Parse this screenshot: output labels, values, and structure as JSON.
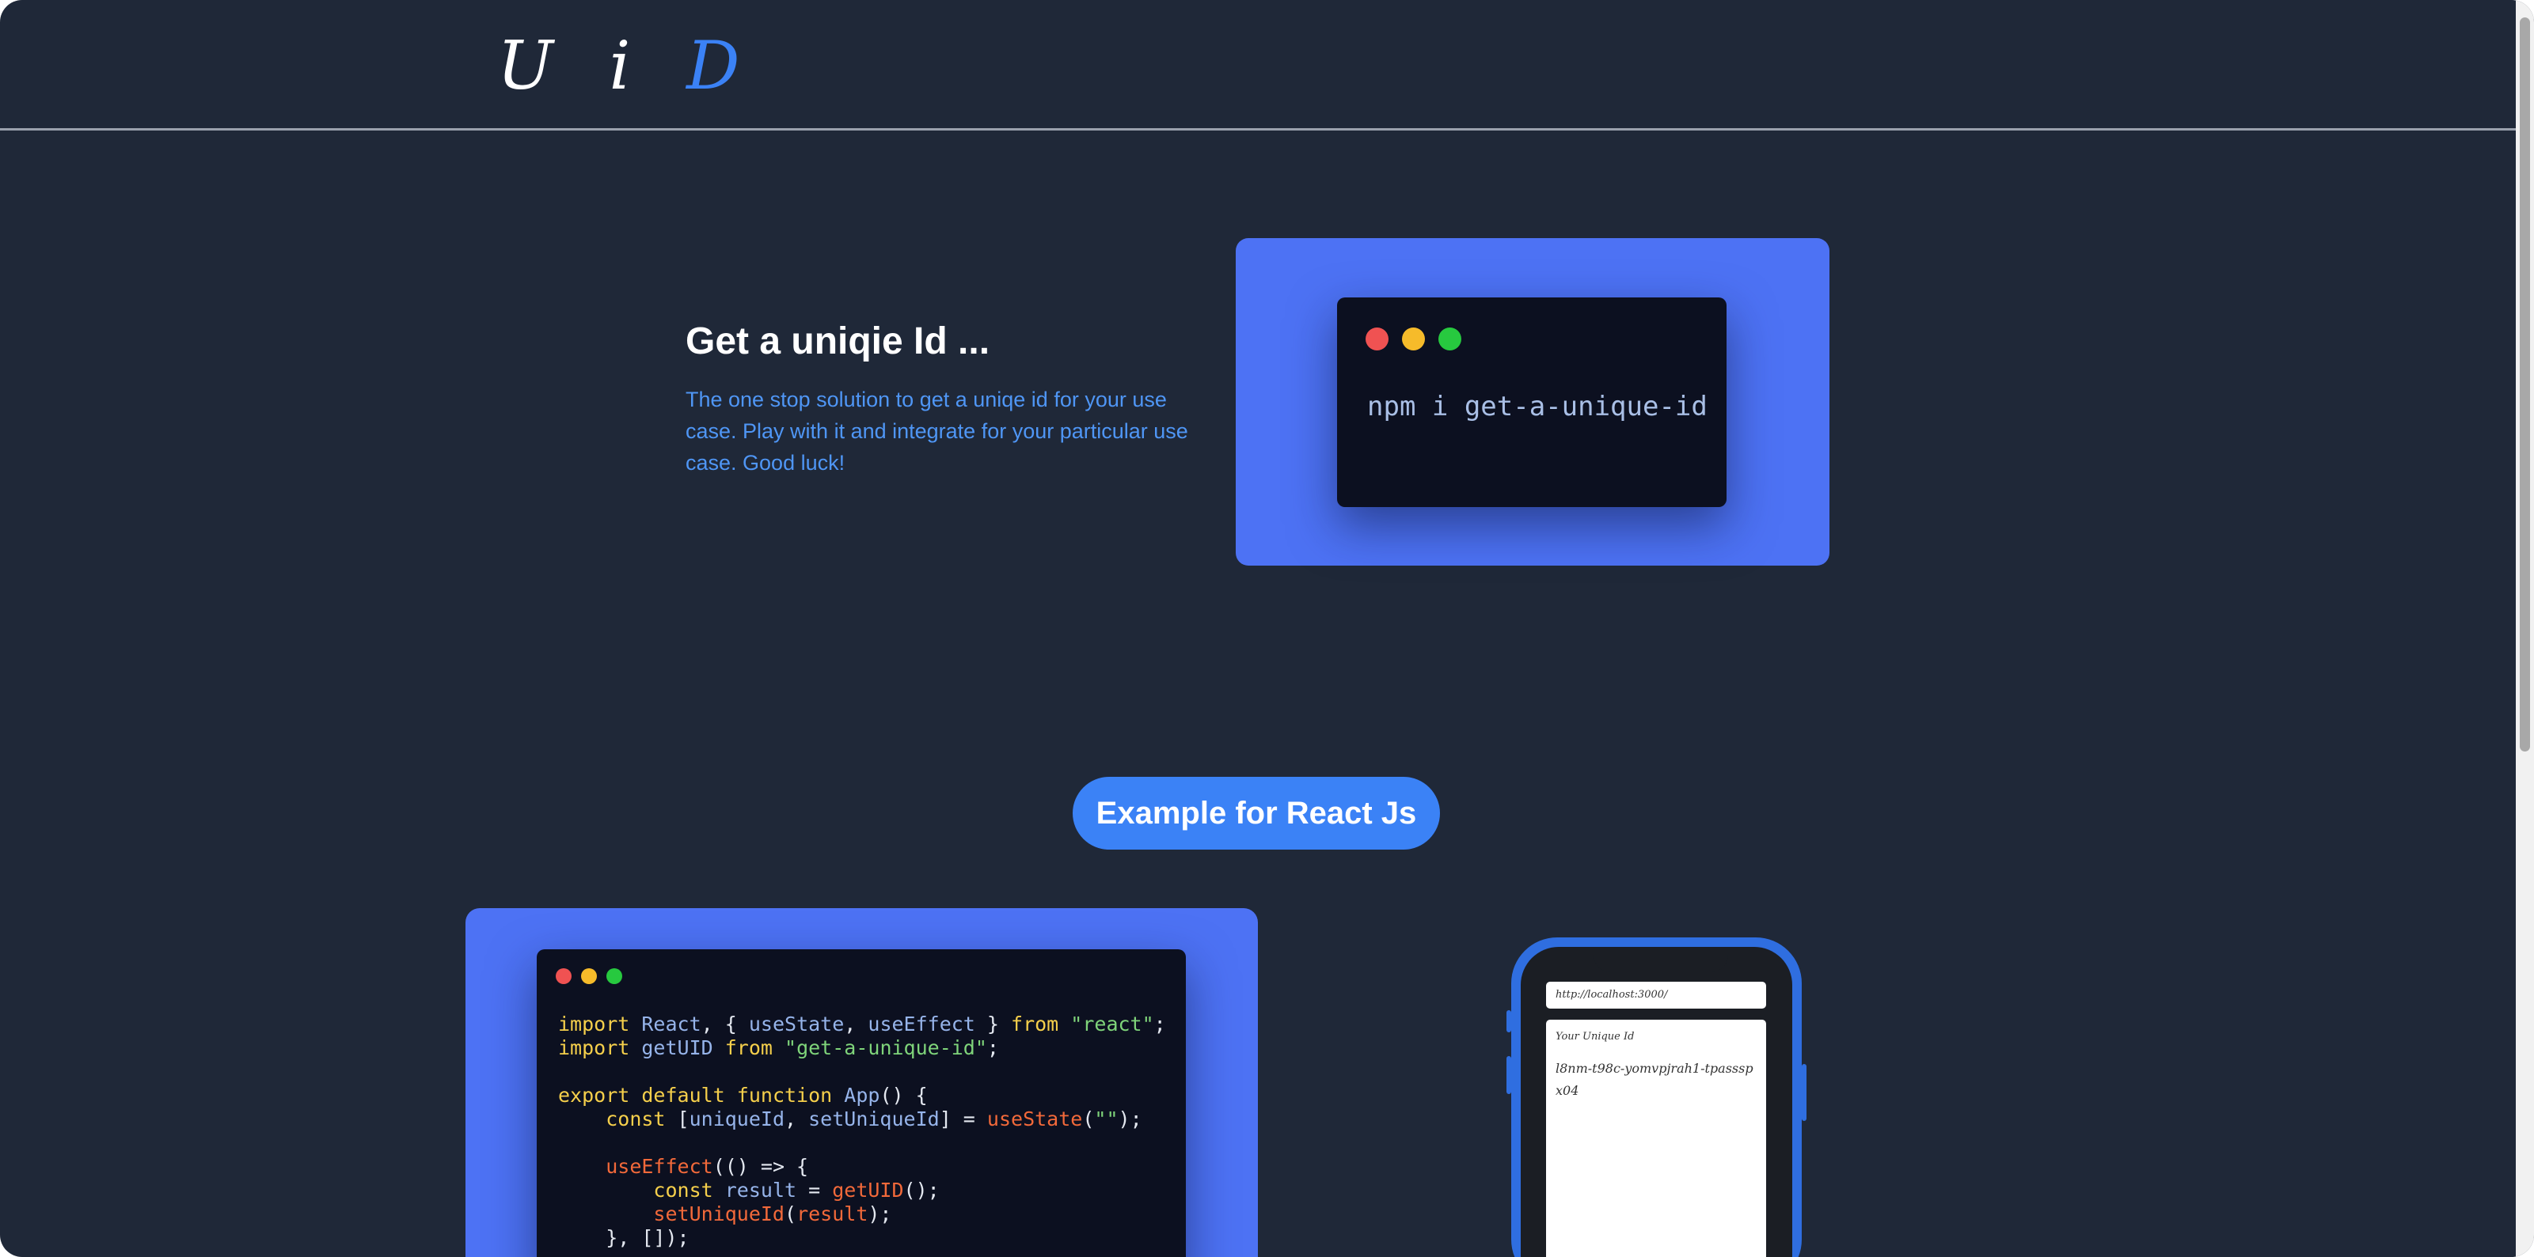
{
  "header": {
    "logo_main": "U i ",
    "logo_accent": "D"
  },
  "hero": {
    "title": "Get a uniqie Id ...",
    "description": "The one stop solution to get a uniqe id for your use case. Play with it and integrate for your particular use case. Good luck!",
    "install_command": "npm i get-a-unique-id"
  },
  "example": {
    "button_label": "Example for React Js",
    "code_tokens": {
      "import": "import",
      "react": "React",
      "open_brace": ", { ",
      "use_state": "useState",
      "comma": ", ",
      "use_effect": "useEffect",
      "close_brace": " } ",
      "from": "from",
      "react_str": "\"react\"",
      "semi": ";",
      "get_uid": "getUID",
      "pkg_str": "\"get-a-unique-id\"",
      "export": "export",
      "default": "default",
      "function": "function",
      "app": "App",
      "app_sig": "() {",
      "const": "const",
      "open_bracket": " [",
      "unique_id": "uniqueId",
      "set_unique_id": "setUniqueId",
      "close_bracket_eq": "] = ",
      "empty_str": "\"\"",
      "close_paren_semi": ");",
      "arrow_open": "(() => {",
      "result": "result",
      "eq": " = ",
      "call_semi": "();",
      "open_paren": "(",
      "effect_close": "}, []);"
    }
  },
  "phone": {
    "url": "http://localhost:3000/",
    "label": "Your Unique Id",
    "unique_id": "l8nm-t98c-yomvpjrah1-tpassspx04"
  },
  "colors": {
    "background": "#1f2838",
    "accent": "#3b82f6",
    "card": "#4d72f4",
    "terminal": "#0c1020"
  }
}
